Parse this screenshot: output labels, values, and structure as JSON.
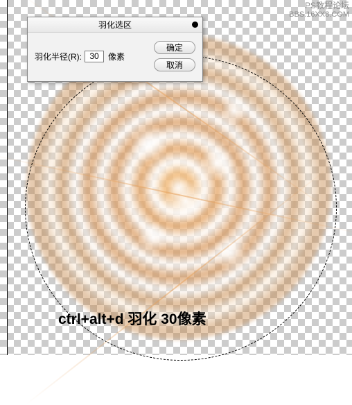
{
  "watermark": {
    "line1": "PS教程论坛",
    "line2": "BBS.16XX8.COM"
  },
  "dialog": {
    "title": "羽化选区",
    "radius_label": "羽化半径(R):",
    "radius_value": "30",
    "unit": "像素",
    "ok_label": "确定",
    "cancel_label": "取消"
  },
  "caption": "ctrl+alt+d  羽化 30像素"
}
